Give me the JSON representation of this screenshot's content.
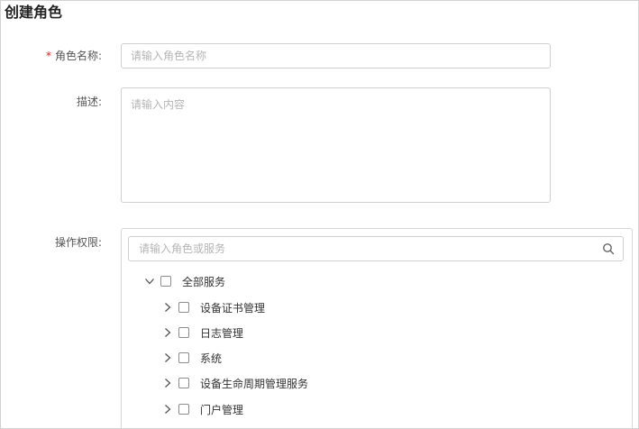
{
  "page": {
    "title": "创建角色"
  },
  "form": {
    "role_name": {
      "required_mark": "*",
      "label": "角色名称:",
      "placeholder": "请输入角色名称"
    },
    "description": {
      "label": "描述:",
      "placeholder": "请输入内容"
    },
    "permissions": {
      "label": "操作权限:",
      "search_placeholder": "请输入角色或服务",
      "tree": {
        "root": {
          "label": "全部服务",
          "expanded": true,
          "checked": false
        },
        "children": [
          {
            "label": "设备证书管理",
            "expanded": false,
            "checked": false
          },
          {
            "label": "日志管理",
            "expanded": false,
            "checked": false
          },
          {
            "label": "系统",
            "expanded": false,
            "checked": false
          },
          {
            "label": "设备生命周期管理服务",
            "expanded": false,
            "checked": false
          },
          {
            "label": "门户管理",
            "expanded": false,
            "checked": false
          }
        ]
      }
    }
  },
  "icons": {
    "search": "search-icon",
    "expanded": "chevron-down-icon",
    "collapsed": "chevron-right-icon"
  },
  "colors": {
    "required": "#e02020",
    "border": "#cfcfcf",
    "placeholder": "#b5b5b5"
  }
}
